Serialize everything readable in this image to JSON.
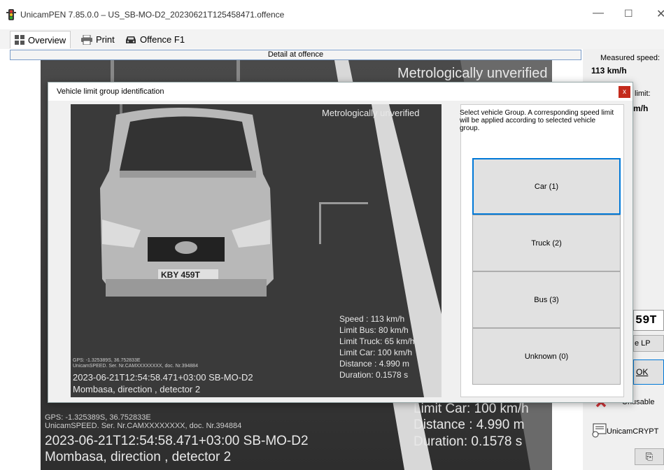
{
  "window": {
    "title": "UnicamPEN 7.85.0.0 – US_SB-MO-D2_20230621T125458471.offence",
    "min": "—",
    "max": "☐",
    "close": "✕"
  },
  "tabs": [
    {
      "label": "Overview"
    },
    {
      "label": "Print"
    },
    {
      "label": "Offence F1"
    }
  ],
  "detail_header": "Detail at offence",
  "main_overlay": {
    "unverified": "Metrologically unverified",
    "limit_car": "Limit Car: 100 km/h",
    "distance": "Distance : 4.990 m",
    "duration": "Duration: 0.1578 s",
    "gps": "GPS: -1.325389S, 36.752833E",
    "serial": "UnicamSPEED. Ser. Nr.CAMXXXXXXXX, doc. Nr.394884",
    "timestamp": "2023-06-21T12:54:58.471+03:00 SB-MO-D2",
    "location": "Mombasa, direction , detector 2"
  },
  "right_panel": {
    "measured_label": "Measured speed:",
    "measured_value": "113 km/h",
    "limit_label": "limit:",
    "limit_value": "m/h",
    "plate_partial": "59T",
    "change_lp": "e LP",
    "ok": "OK",
    "unusable": "Unusable",
    "crypt": "UnicamCRYPT",
    "bottom_icon": "⎘"
  },
  "modal": {
    "title": "Vehicle limit group identification",
    "close": "x",
    "instruction": "Select vehicle Group.  A corresponding speed limit will be applied according to selected  vehicle group.",
    "overlay": {
      "unverified": "Metrologically unverified",
      "plate": "KBY 459T",
      "speed": "Speed    : 113 km/h",
      "limit_bus": "Limit Bus: 80 km/h",
      "limit_truck": "Limit Truck: 65 km/h",
      "limit_car": "Limit Car: 100 km/h",
      "distance": "Distance : 4.990 m",
      "duration": "Duration: 0.1578 s",
      "gps": "GPS: -1.325389S, 36.752833E",
      "serial": "UnicamSPEED. Ser. Nr.CAMXXXXXXXX, doc. Nr.394884",
      "timestamp": "2023-06-21T12:54:58.471+03:00 SB-MO-D2",
      "location": "Mombasa, direction , detector 2"
    },
    "buttons": [
      {
        "label": "Car (1)",
        "selected": true
      },
      {
        "label": "Truck (2)"
      },
      {
        "label": "Bus (3)"
      },
      {
        "label": "Unknown (0)"
      }
    ]
  },
  "colors": {
    "accent": "#0078d7",
    "close_red": "#c42b1c",
    "unusable_red": "#d13438"
  }
}
